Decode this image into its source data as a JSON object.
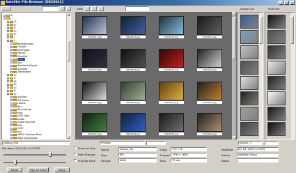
{
  "window": {
    "title": "Satellite File Browser [DSC0011]",
    "buttons": [
      "_",
      "□",
      "×"
    ]
  },
  "toolbar": {
    "view_label": "View",
    "path_placeholder": ""
  },
  "tree": {
    "items": [
      {
        "label": "A:",
        "indent": 0,
        "sel": false
      },
      {
        "label": "C:",
        "indent": 0,
        "sel": false
      },
      {
        "label": "D:",
        "indent": 1,
        "sel": false
      },
      {
        "label": "E:",
        "indent": 1,
        "sel": false
      },
      {
        "label": "F:",
        "indent": 1,
        "sel": false
      },
      {
        "label": "G:",
        "indent": 1,
        "sel": false
      },
      {
        "label": "H:",
        "indent": 1,
        "sel": false
      },
      {
        "label": "I:",
        "indent": 1,
        "sel": false
      },
      {
        "label": "J:",
        "indent": 1,
        "sel": false
      },
      {
        "label": "Backgrounds",
        "indent": 2,
        "sel": false
      },
      {
        "label": "Clouds",
        "indent": 2,
        "sel": false
      },
      {
        "label": "Earthlight",
        "indent": 2,
        "sel": false
      },
      {
        "label": "Planet",
        "indent": 2,
        "sel": false
      },
      {
        "label": "Satellite",
        "indent": 2,
        "sel": false
      },
      {
        "label": "Space",
        "indent": 2,
        "sel": true
      },
      {
        "label": "Sky",
        "indent": 2,
        "sel": false
      },
      {
        "label": "Starfield_Moods",
        "indent": 2,
        "sel": false
      },
      {
        "label": "Sunsets",
        "indent": 2,
        "sel": false
      },
      {
        "label": "Transitions",
        "indent": 2,
        "sel": false
      },
      {
        "label": "K:",
        "indent": 1,
        "sel": false
      },
      {
        "label": "L:",
        "indent": 1,
        "sel": false
      },
      {
        "label": "M:",
        "indent": 1,
        "sel": false
      },
      {
        "label": "N:",
        "indent": 1,
        "sel": false
      },
      {
        "label": "O:",
        "indent": 1,
        "sel": false
      },
      {
        "label": "P:",
        "indent": 1,
        "sel": false
      },
      {
        "label": "Q:",
        "indent": 1,
        "sel": false
      },
      {
        "label": "Archive",
        "indent": 2,
        "sel": false
      },
      {
        "label": "Art Items",
        "indent": 2,
        "sel": false
      },
      {
        "label": "Labels",
        "indent": 2,
        "sel": false
      },
      {
        "label": "Bin",
        "indent": 2,
        "sel": false
      },
      {
        "label": "Recordings",
        "indent": 2,
        "sel": false
      },
      {
        "label": "Misc",
        "indent": 2,
        "sel": false
      },
      {
        "label": "DVD clips",
        "indent": 2,
        "sel": false
      },
      {
        "label": "Audio",
        "indent": 2,
        "sel": false
      },
      {
        "label": "Audio sources",
        "indent": 2,
        "sel": false
      },
      {
        "label": "EDL",
        "indent": 2,
        "sel": false
      },
      {
        "label": "MOV",
        "indent": 2,
        "sel": false
      },
      {
        "label": "AVI",
        "indent": 2,
        "sel": false
      },
      {
        "label": "MPEG Preview Files",
        "indent": 2,
        "sel": false
      },
      {
        "label": "WAV Soundclips",
        "indent": 2,
        "sel": false
      }
    ]
  },
  "thumbs": [
    {
      "cap": "DSC0011.jpg",
      "c1": "#203050",
      "c2": "#c0c8d8"
    },
    {
      "cap": "DSC0012.jpg",
      "c1": "#102030",
      "c2": "#4060a0"
    },
    {
      "cap": "DSC0013.jpg",
      "c1": "#203040",
      "c2": "#80c0e0"
    },
    {
      "cap": "DSC0014.jpg",
      "c1": "#181818",
      "c2": "#606060"
    },
    {
      "cap": "DSC0015.jpg",
      "c1": "#101018",
      "c2": "#303040"
    },
    {
      "cap": "DSC0016.jpg",
      "c1": "#101010",
      "c2": "#505050"
    },
    {
      "cap": "DSC0017.jpg",
      "c1": "#300808",
      "c2": "#c02020"
    },
    {
      "cap": "DSC0018.jpg",
      "c1": "#202020",
      "c2": "#d0d0d0"
    },
    {
      "cap": "DSC0019.jpg",
      "c1": "#101010",
      "c2": "#e0e0e0"
    },
    {
      "cap": "DSC0020.jpg",
      "c1": "#304030",
      "c2": "#a0b090"
    },
    {
      "cap": "DSC0021.jpg",
      "c1": "#604010",
      "c2": "#e0b040"
    },
    {
      "cap": "DSC0022.jpg",
      "c1": "#202020",
      "c2": "#c08030"
    },
    {
      "cap": "DSC0023.jpg",
      "c1": "#102010",
      "c2": "#408040"
    },
    {
      "cap": "DSC0024.jpg",
      "c1": "#102040",
      "c2": "#3060c0"
    },
    {
      "cap": "DSC0025.jpg",
      "c1": "#181818",
      "c2": "#707070"
    },
    {
      "cap": "DSC0026.jpg",
      "c1": "#202020",
      "c2": "#b09070"
    }
  ],
  "side1": {
    "header": "Image List",
    "thumbs": [
      "#3060a0",
      "#80a0c0",
      "#c0c0c0",
      "#505050",
      "#e0e0e0",
      "#202020",
      "#a0a0a0",
      "#404040"
    ]
  },
  "side2": {
    "header": "Shot List",
    "thumbs": [
      "#101010",
      "#505050",
      "#303030",
      "#e8e8e8",
      "#202020",
      "#fafafa",
      "#151515",
      "#0a0a0a"
    ]
  },
  "bottom": {
    "search_value": "Galaxy_008",
    "info_line": "File date: 03/07/06 12:32 PM",
    "fields_left": [
      {
        "label": "Name",
        "value": "Galaxy_08"
      },
      {
        "label": "Type",
        "value": "JPG"
      },
      {
        "label": "Format",
        "value": "B&W"
      }
    ],
    "fields_mid": [
      {
        "label": "Class",
        "value": "172 776"
      },
      {
        "label": "Frames",
        "value": "1790 x 1630"
      },
      {
        "label": "Size",
        "value": "72 dpi"
      }
    ],
    "fields_right": [
      {
        "label": "Modified",
        "value": "Jan 16, 2006 1:24 PM"
      },
      {
        "label": "Author",
        "value": "Satellite Group"
      },
      {
        "label": "Notes",
        "value": ""
      }
    ],
    "checks": [
      "Show all files",
      "Hide Preview",
      "Preview Pane"
    ],
    "buttons": [
      "Reset",
      "Play all items",
      "Done"
    ],
    "right_top": "Anchor: 1",
    "mid_top": "Preview"
  }
}
